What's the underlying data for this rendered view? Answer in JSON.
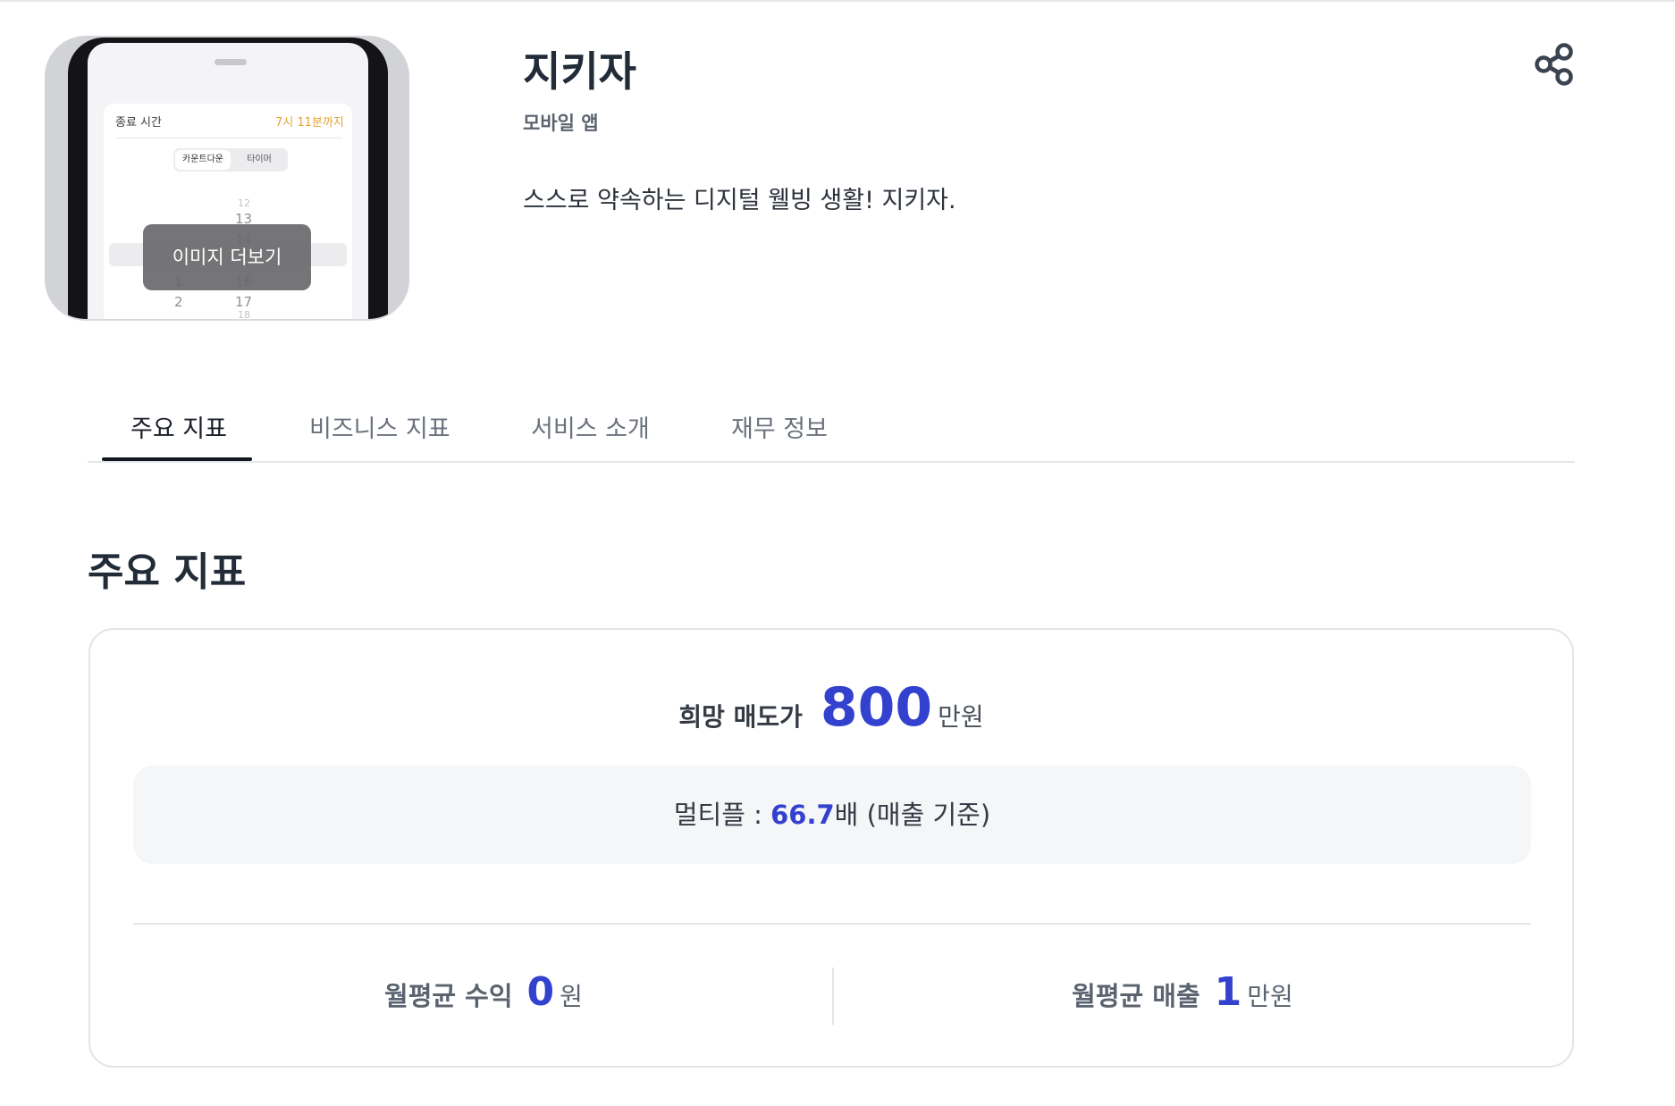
{
  "app": {
    "title": "지키자",
    "category": "모바일 앱",
    "description": "스스로 약속하는 디지털 웰빙 생활! 지키자."
  },
  "thumbnail": {
    "more_images_label": "이미지 더보기",
    "screen": {
      "end_time_label": "종료 시간",
      "end_time_value": "7시 11분까지",
      "segment_countdown": "카운트다운",
      "segment_timer": "타이머",
      "picker_left": [
        "1",
        "2"
      ],
      "picker_right": [
        "12",
        "13",
        "14",
        "16",
        "17",
        "18"
      ]
    }
  },
  "share": {
    "icon": "share-icon"
  },
  "tabs": [
    {
      "label": "주요 지표",
      "active": true
    },
    {
      "label": "비즈니스 지표",
      "active": false
    },
    {
      "label": "서비스 소개",
      "active": false
    },
    {
      "label": "재무 정보",
      "active": false
    }
  ],
  "metrics": {
    "section_title": "주요 지표",
    "asking_price_label": "희망 매도가",
    "asking_price_value": "800",
    "asking_price_unit": "만원",
    "multiple_label": "멀티플 : ",
    "multiple_value": "66.7",
    "multiple_suffix": "배 (매출 기준)",
    "monthly_profit_label": "월평균 수익",
    "monthly_profit_value": "0",
    "monthly_profit_unit": "원",
    "monthly_revenue_label": "월평균 매출",
    "monthly_revenue_value": "1",
    "monthly_revenue_unit": "만원"
  },
  "colors": {
    "accent": "#3341cf",
    "text_primary": "#222b38",
    "text_secondary": "#5b6370",
    "border": "#e2e4e8",
    "panel_bg": "#f5f6f8",
    "time_highlight": "#e3a338"
  }
}
